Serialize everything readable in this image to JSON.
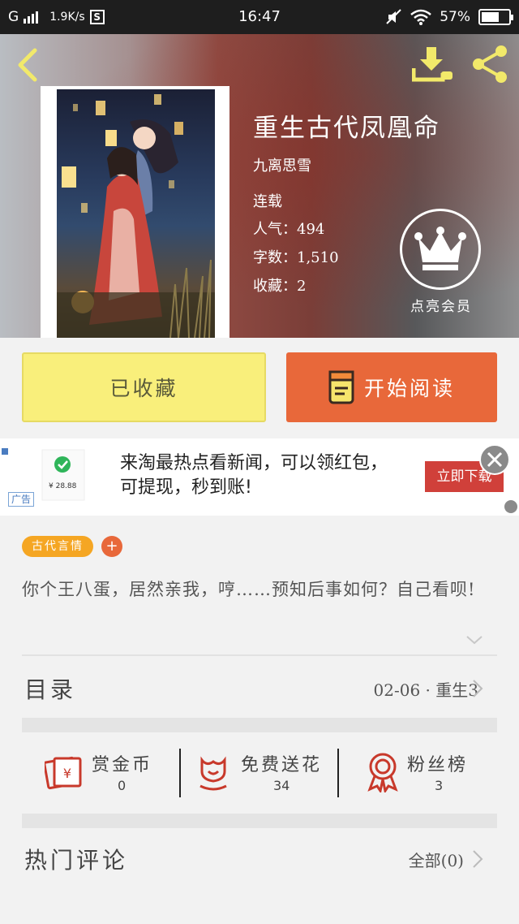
{
  "status_bar": {
    "carrier": "G",
    "speed": "1.9K/s",
    "s_badge": "S",
    "time": "16:47",
    "battery": "57%"
  },
  "book": {
    "title": "重生古代凤凰命",
    "author": "九离思雪",
    "status": "连载",
    "popularity": "人气：494",
    "word_count": "字数：1,510",
    "favorites": "收藏：2"
  },
  "member": {
    "label": "点亮会员"
  },
  "actions": {
    "favorited_label": "已收藏",
    "read_label": "开始阅读"
  },
  "ad": {
    "text": "来淘最热点看新闻，可以领红包，可提现，秒到账!",
    "cta": "立即下载",
    "tag": "广告",
    "thumb_amount": "¥ 28.88"
  },
  "tags": [
    {
      "label": "古代言情"
    }
  ],
  "tag_add": "+",
  "description": "你个王八蛋，居然亲我，哼……预知后事如何？自己看呗!",
  "toc": {
    "label": "目录",
    "latest": "02-06 · 重生3"
  },
  "stats": [
    {
      "label": "赏金币",
      "value": "0"
    },
    {
      "label": "免费送花",
      "value": "34"
    },
    {
      "label": "粉丝榜",
      "value": "3"
    }
  ],
  "comments": {
    "label": "热门评论",
    "all": "全部(0)"
  },
  "colors": {
    "accent_orange": "#e8683a",
    "favorite_yellow": "#f9ef7b",
    "tag_orange": "#f5a623",
    "icon_red": "#c8392b",
    "icon_yellow": "#f2e96a"
  }
}
